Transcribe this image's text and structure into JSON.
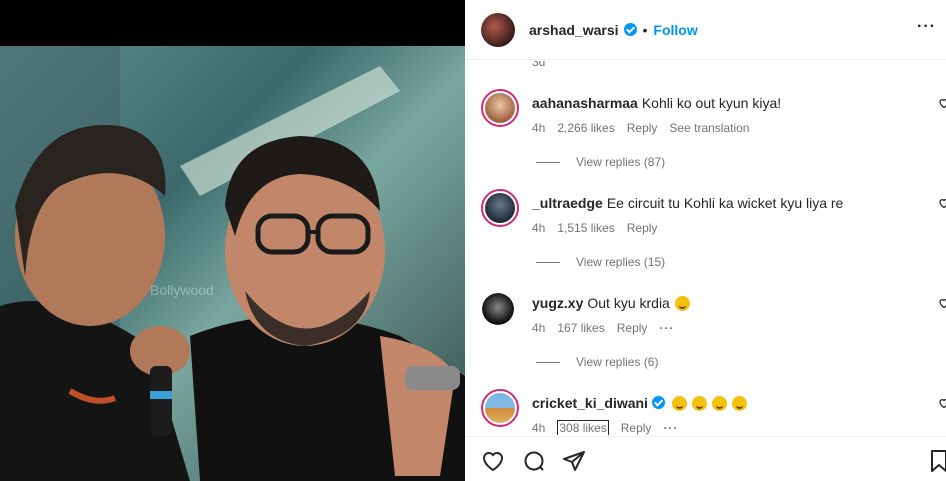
{
  "post": {
    "username": "arshad_warsi",
    "separator": "•",
    "follow_label": "Follow",
    "more_label": "···",
    "time_top": "3d",
    "watermark": "Bollywood"
  },
  "comments": [
    {
      "username": "aahanasharmaa",
      "text": "Kohli ko out kyun kiya!",
      "time": "4h",
      "likes": "2,266 likes",
      "reply": "Reply",
      "translation": "See translation",
      "replies": "View replies (87)"
    },
    {
      "username": "_ultraedge",
      "text": "Ee circuit tu Kohli ka wicket kyu liya re",
      "time": "4h",
      "likes": "1,515 likes",
      "reply": "Reply",
      "replies": "View replies (15)"
    },
    {
      "username": "yugz.xy",
      "text": "Out kyu krdia",
      "time": "4h",
      "likes": "167 likes",
      "reply": "Reply",
      "more": "···",
      "replies": "View replies (6)"
    },
    {
      "username": "cricket_ki_diwani",
      "time": "4h",
      "likes": "308 likes",
      "reply": "Reply",
      "more": "···"
    }
  ],
  "colors": {
    "link": "#0095f6",
    "text": "#262626",
    "secondary": "#737373",
    "story_ring": "#d62976"
  },
  "icons": [
    "verified-badge-icon",
    "heart-icon",
    "comment-icon",
    "share-icon",
    "bookmark-icon",
    "emoji-icon"
  ]
}
